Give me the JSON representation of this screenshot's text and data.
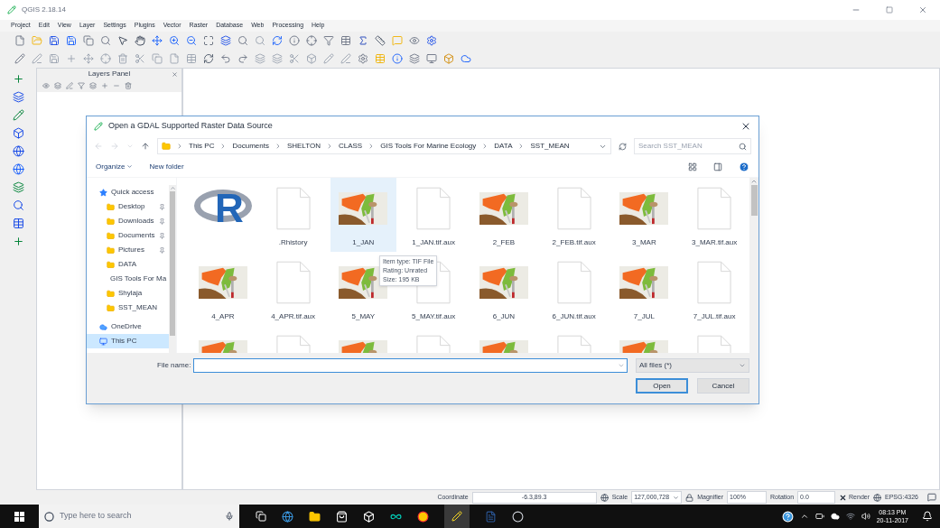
{
  "window": {
    "title": "QGIS 2.18.14"
  },
  "menu": [
    "Project",
    "Edit",
    "View",
    "Layer",
    "Settings",
    "Plugins",
    "Vector",
    "Raster",
    "Database",
    "Web",
    "Processing",
    "Help"
  ],
  "layers_panel": {
    "title": "Layers Panel"
  },
  "dialog": {
    "title": "Open a GDAL Supported Raster Data Source",
    "breadcrumb": [
      "This PC",
      "Documents",
      "SHELTON",
      "CLASS",
      "GIS Tools For Marine Ecology",
      "DATA",
      "SST_MEAN"
    ],
    "search": {
      "placeholder": "Search SST_MEAN"
    },
    "commands": [
      {
        "label": "Organize",
        "dropdown": true
      },
      {
        "label": "New folder",
        "dropdown": false
      }
    ],
    "nav": [
      {
        "label": "Quick access",
        "kind": "star",
        "selected": false,
        "children": [
          {
            "label": "Desktop",
            "kind": "folder",
            "pinned": true,
            "selected": false
          },
          {
            "label": "Downloads",
            "kind": "folder",
            "pinned": true,
            "selected": false
          },
          {
            "label": "Documents",
            "kind": "folder",
            "pinned": true,
            "selected": false
          },
          {
            "label": "Pictures",
            "kind": "folder",
            "pinned": true,
            "selected": false
          },
          {
            "label": "DATA",
            "kind": "folder",
            "pinned": false,
            "selected": false
          },
          {
            "label": "GIS Tools For Ma",
            "kind": "folder",
            "pinned": false,
            "selected": false
          },
          {
            "label": "Shylaja",
            "kind": "folder",
            "pinned": false,
            "selected": false
          },
          {
            "label": "SST_MEAN",
            "kind": "folder",
            "pinned": false,
            "selected": false
          }
        ]
      },
      {
        "label": "OneDrive",
        "kind": "cloud",
        "selected": false
      },
      {
        "label": "This PC",
        "kind": "pc",
        "selected": true
      }
    ],
    "files": [
      {
        "kind": "r",
        "logo_text": "R",
        "selected": false
      },
      {
        "kind": "doc",
        "label": ".Rhistory",
        "selected": false
      },
      {
        "kind": "map",
        "label": "1_JAN",
        "selected": true
      },
      {
        "kind": "doc",
        "label": "1_JAN.tif.aux",
        "selected": false
      },
      {
        "kind": "map",
        "label": "2_FEB",
        "selected": false
      },
      {
        "kind": "doc",
        "label": "2_FEB.tif.aux",
        "selected": false
      },
      {
        "kind": "map",
        "label": "3_MAR",
        "selected": false
      },
      {
        "kind": "doc",
        "label": "3_MAR.tif.aux",
        "selected": false
      },
      {
        "kind": "map",
        "label": "4_APR",
        "selected": false
      },
      {
        "kind": "doc",
        "label": "4_APR.tif.aux",
        "selected": false
      },
      {
        "kind": "map",
        "label": "5_MAY",
        "selected": false
      },
      {
        "kind": "doc",
        "label": "5_MAY.tif.aux",
        "selected": false
      },
      {
        "kind": "map",
        "label": "6_JUN",
        "selected": false
      },
      {
        "kind": "doc",
        "label": "6_JUN.tif.aux",
        "selected": false
      },
      {
        "kind": "map",
        "label": "7_JUL",
        "selected": false
      },
      {
        "kind": "doc",
        "label": "7_JUL.tif.aux",
        "selected": false
      },
      {
        "kind": "map",
        "selected": false
      },
      {
        "kind": "doc",
        "selected": false
      },
      {
        "kind": "map",
        "selected": false
      },
      {
        "kind": "doc",
        "selected": false
      },
      {
        "kind": "map",
        "selected": false
      },
      {
        "kind": "doc",
        "selected": false
      },
      {
        "kind": "map",
        "selected": false
      },
      {
        "kind": "doc",
        "selected": false
      }
    ],
    "tooltip": [
      "Item type: TIF File",
      "Rating: Unrated",
      "Size: 195 KB"
    ],
    "file_name": {
      "label": "File name:"
    },
    "file_type": "All files (*)",
    "buttons": [
      "Open",
      "Cancel"
    ]
  },
  "status_bar": {
    "coordinate_label": "Coordinate",
    "coordinate": "-6.3,89.3",
    "scale_label": "Scale",
    "scale": "127,000,728",
    "magnifier_label": "Magnifier",
    "magnifier": "100%",
    "rotation_label": "Rotation",
    "rotation": "0.0",
    "render": {
      "label": "Render",
      "checked": true
    },
    "crs": "EPSG:4326"
  },
  "taskbar": {
    "search": {
      "placeholder": "Type here to search"
    },
    "time": "08:13 PM",
    "date": "20-11-2017"
  }
}
